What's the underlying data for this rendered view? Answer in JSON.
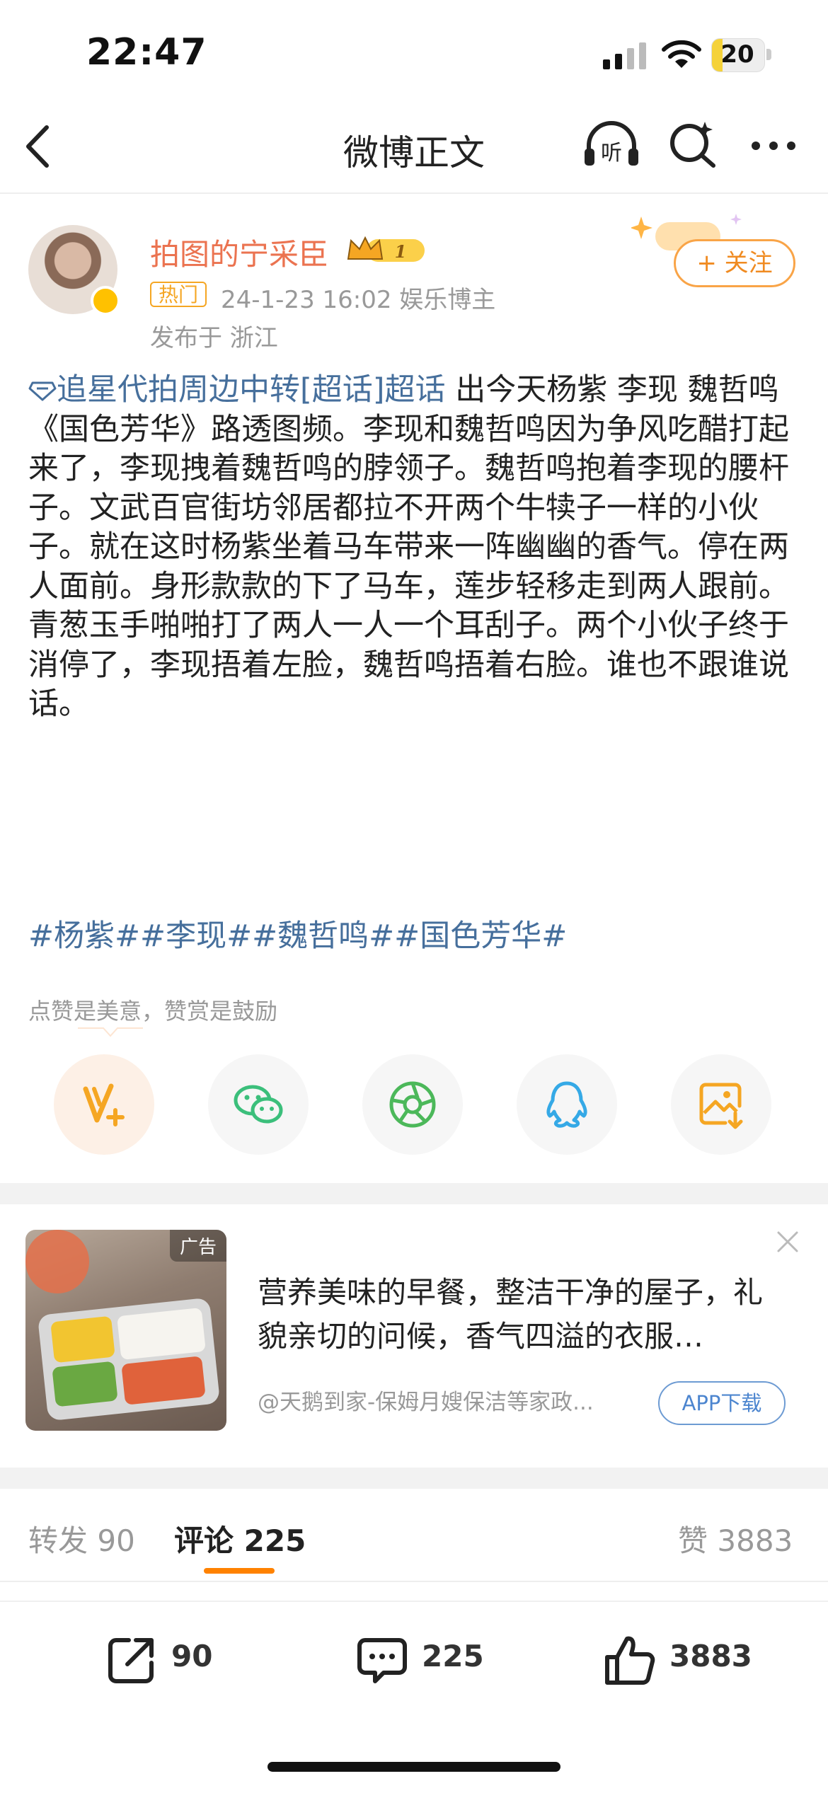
{
  "status_bar": {
    "time": "22:47",
    "battery": "20",
    "battery_level": 0.2
  },
  "nav": {
    "title": "微博正文",
    "listen_label": "听"
  },
  "post": {
    "author": "拍图的宁采臣",
    "vip_level": "1",
    "hot_tag": "热门",
    "meta": "24-1-23 16:02  娱乐博主",
    "location": "发布于 浙江",
    "follow_label": "+ 关注",
    "topic_link": "追星代拍周边中转[超话]超话",
    "body": " 出今天杨紫 李现 魏哲鸣《国色芳华》路透图频。李现和魏哲鸣因为争风吃醋打起来了，李现拽着魏哲鸣的脖领子。魏哲鸣抱着李现的腰杆子。文武百官街坊邻居都拉不开两个牛犊子一样的小伙子。就在这时杨紫坐着马车带来一阵幽幽的香气。停在两人面前。身形款款的下了马车，莲步轻移走到两人跟前。青葱玉手啪啪打了两人一人一个耳刮子。两个小伙子终于消停了，李现捂着左脸，魏哲鸣捂着右脸。谁也不跟谁说话。",
    "hashtags": "#杨紫##李现##魏哲鸣##国色芳华#",
    "reward_hint": "点赞是美意，赞赏是鼓励"
  },
  "share": [
    {
      "name": "reward-v-icon",
      "color": "#f5a623"
    },
    {
      "name": "wechat-icon",
      "color": "#3bbf7b"
    },
    {
      "name": "moments-icon",
      "color": "#4cb85a"
    },
    {
      "name": "qq-icon",
      "color": "#35a9e6"
    },
    {
      "name": "save-image-icon",
      "color": "#f5a623"
    }
  ],
  "ad": {
    "label": "广告",
    "title": "营养美味的早餐，整洁干净的屋子，礼貌亲切的问候，香气四溢的衣服…",
    "source": "@天鹅到家-保姆月嫂保洁等家政...",
    "cta": "APP下载"
  },
  "tabs": {
    "repost_label": "转发",
    "repost_count": "90",
    "comment_label": "评论",
    "comment_count": "225",
    "like_label": "赞",
    "like_count": "3883"
  },
  "actions": {
    "repost": "90",
    "comment": "225",
    "like": "3883"
  },
  "colors": {
    "accent": "#ff8200",
    "link": "#466f9c",
    "author": "#eb7350"
  }
}
